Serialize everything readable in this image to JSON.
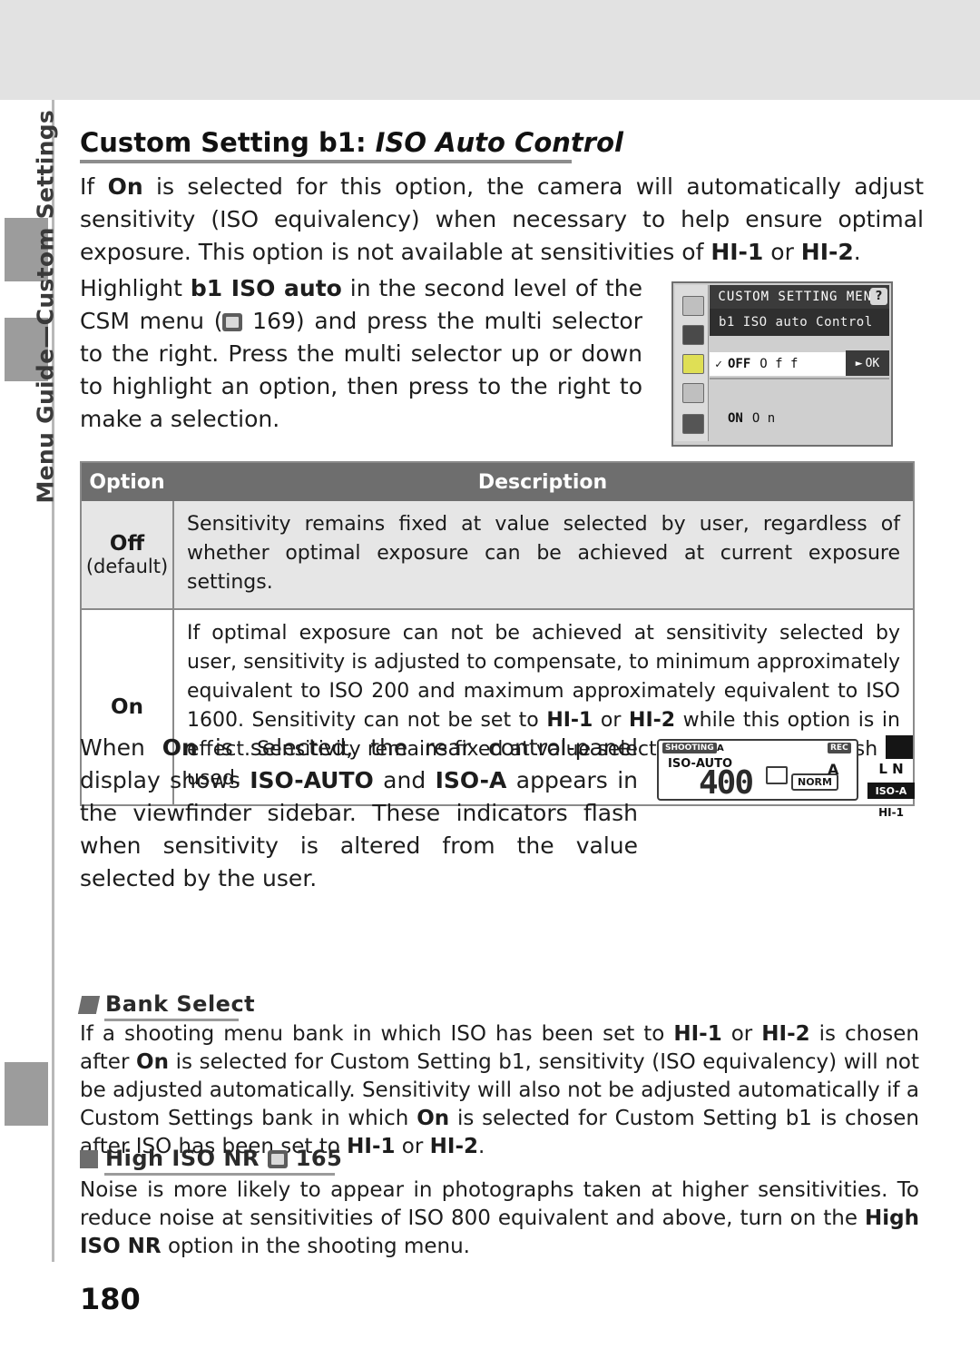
{
  "page": {
    "number": "180",
    "side_tab_label": "Menu Guide—Custom Settings"
  },
  "heading": {
    "prefix": "Custom Setting b1: ",
    "italic": "ISO Auto Control"
  },
  "intro": {
    "html": "If <b>On</b> is selected for this option, the camera will automatically adjust sensitivity (ISO equivalency) when necessary to help ensure optimal exposure.  This option is not available at sensitivities of <b>HI-1</b> or <b>HI-2</b>."
  },
  "instructions": {
    "html": "Highlight <b>b1 ISO auto</b> in the second level of the CSM menu (<span class=\"ref-ico\"></span> 169) and press the multi selector to the right.  Press the multi selector up or down to highlight an option, then press to the right to make a selection."
  },
  "lcd": {
    "title": "CUSTOM SETTING MENU",
    "help_icon": "?",
    "subtitle": "b1  ISO auto Control",
    "rows": [
      {
        "check": "✓",
        "key": "OFF",
        "label": "O f f",
        "ok": "OK"
      },
      {
        "check": "",
        "key": "ON",
        "label": "O n",
        "ok": ""
      }
    ]
  },
  "table": {
    "headers": {
      "option": "Option",
      "description": "Description"
    },
    "rows": [
      {
        "option": "Off",
        "option_sub": "(default)",
        "description": "Sensitivity remains fixed at value selected by user, regardless of whether optimal exposure can be achieved at current exposure settings."
      },
      {
        "option": "On",
        "option_sub": "",
        "description_html": "If optimal exposure can not be achieved at sensitivity selected by user, sensitivity is adjusted to compensate, to minimum approximately equivalent to ISO 200 and maximum approximately equivalent to ISO 1600.  Sensitivity can not be set to <b>HI-1</b> or <b>HI-2</b> while this option is in effect.  Sensitivity remains fixed at value selected by user when flash is used."
      }
    ]
  },
  "after_table": {
    "html": "When <b>On</b> is selected, the rear control-panel display shows <b>ISO-AUTO</b> and <b>ISO-A</b> appears in the viewfinder sidebar.  These indicators flash when sensitivity is altered from the value selected by the user."
  },
  "control_panel": {
    "shooting_tag": "SHOOTING",
    "menu_tag": "A",
    "iso_auto": "ISO-AUTO",
    "value": "400",
    "quality": "NORM",
    "mode_letter": "A",
    "rec_badge": "REC",
    "viewfinder_letters": "L N",
    "viewfinder_iso": "ISO-A",
    "viewfinder_burst": "HI-1"
  },
  "notes": [
    {
      "icon": "pencil-icon",
      "title": "Bank Select",
      "body_html": "If a shooting menu bank in which ISO has been set to <b>HI-1</b> or <b>HI-2</b> is chosen after <b>On</b> is selected for Custom Setting b1, sensitivity (ISO equivalency) will not be adjusted automatically.  Sensitivity will also not be adjusted automatically if a Custom Settings bank in which <b>On</b> is selected for Custom Setting b1 is chosen after ISO has been set to <b>HI-1</b> or <b>HI-2</b>."
    },
    {
      "icon": "lines-icon",
      "title": "High ISO NR",
      "title_ref": "165",
      "body_html": "Noise is more likely to appear in photographs taken at higher sensitivities.  To reduce noise at sensitivities of ISO 800 equivalent and above, turn on the <b>High ISO NR</b> option in the shooting menu."
    }
  ]
}
